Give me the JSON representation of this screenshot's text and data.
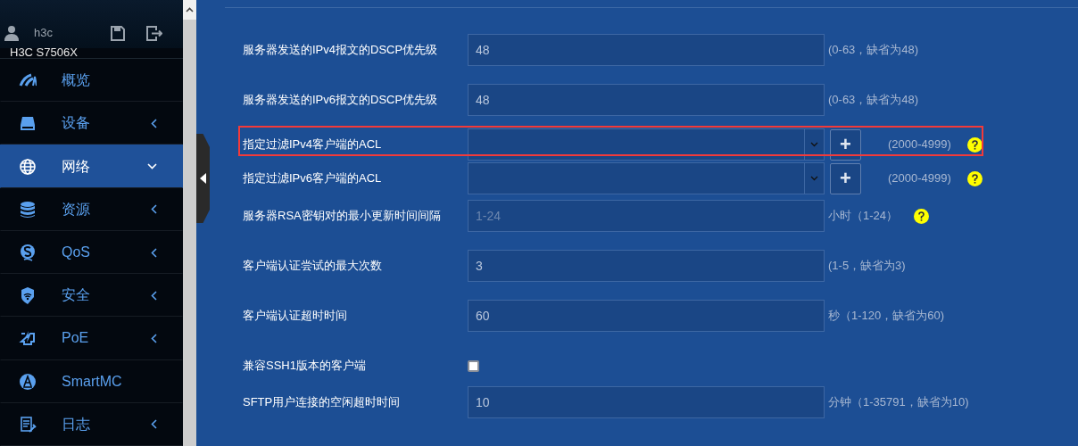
{
  "sidebar": {
    "user": "h3c",
    "device": "H3C S7506X",
    "items": [
      {
        "label": "概览",
        "selected": false
      },
      {
        "label": "设备",
        "expanded": false,
        "selected": false
      },
      {
        "label": "网络",
        "expanded": true,
        "selected": true
      },
      {
        "label": "资源",
        "expanded": false,
        "selected": false
      },
      {
        "label": "QoS",
        "expanded": false,
        "selected": false
      },
      {
        "label": "安全",
        "expanded": false,
        "selected": false
      },
      {
        "label": "PoE",
        "expanded": false,
        "selected": false
      },
      {
        "label": "SmartMC",
        "selected": false
      },
      {
        "label": "日志",
        "expanded": false,
        "selected": false
      }
    ]
  },
  "form": {
    "rows": [
      {
        "kind": "input",
        "label": "服务器发送的IPv4报文的DSCP优先级",
        "value": "48",
        "hint": "(0-63，缺省为48)",
        "help": false,
        "highlighted": false
      },
      {
        "kind": "input",
        "label": "服务器发送的IPv6报文的DSCP优先级",
        "value": "48",
        "hint": "(0-63，缺省为48)",
        "help": false,
        "highlighted": false
      },
      {
        "kind": "select",
        "label": "指定过滤IPv4客户端的ACL",
        "add": "+",
        "hint": "(2000-4999)",
        "help": true,
        "highlighted": true
      },
      {
        "kind": "select",
        "label": "指定过滤IPv6客户端的ACL",
        "add": "+",
        "hint": "(2000-4999)",
        "help": true,
        "highlighted": false
      },
      {
        "kind": "input",
        "label": "服务器RSA密钥对的最小更新时间间隔",
        "placeholder": "1-24",
        "hint": "小时（1-24）",
        "help": true,
        "highlighted": false
      },
      {
        "kind": "input",
        "label": "客户端认证尝试的最大次数",
        "value": "3",
        "hint": "(1-5，缺省为3)",
        "help": false,
        "highlighted": false
      },
      {
        "kind": "input",
        "label": "客户端认证超时时间",
        "value": "60",
        "hint": "秒（1-120，缺省为60)",
        "help": false,
        "highlighted": false
      },
      {
        "kind": "checkbox",
        "label": "兼容SSH1版本的客户端",
        "checked": false,
        "highlighted": false
      },
      {
        "kind": "input",
        "label": "SFTP用户连接的空闲超时时间",
        "value": "10",
        "hint": "分钟（1-35791，缺省为10)",
        "help": false,
        "highlighted": false
      }
    ]
  }
}
